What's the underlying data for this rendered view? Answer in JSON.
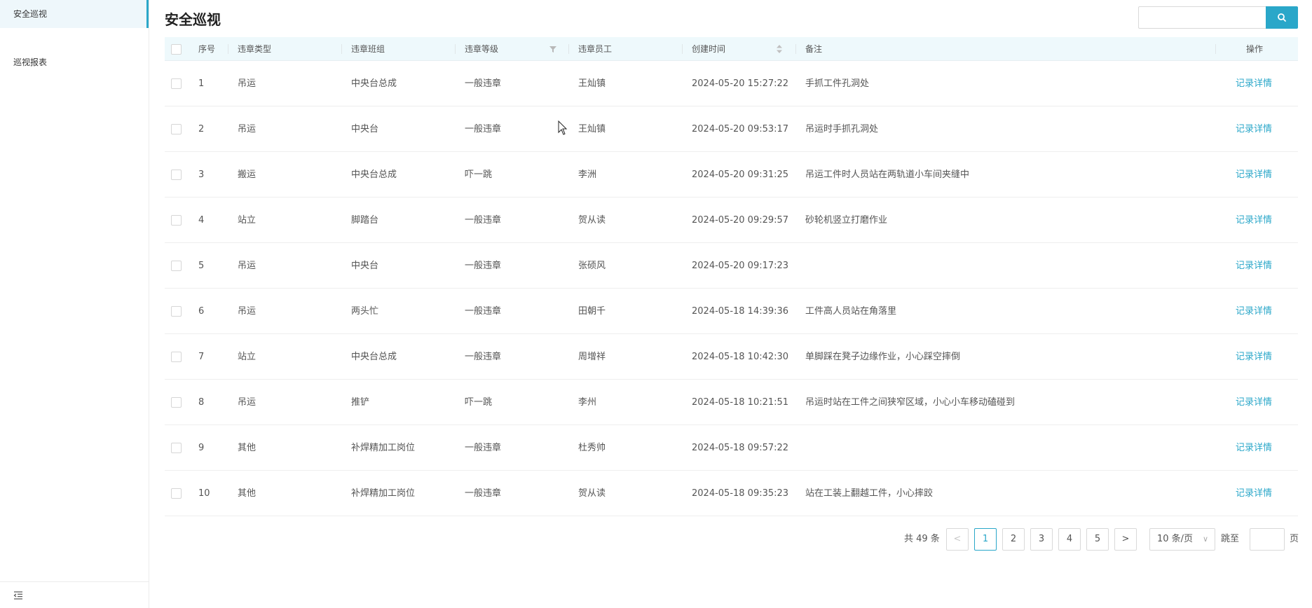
{
  "sidebar": {
    "items": [
      {
        "label": "安全巡视",
        "active": true
      },
      {
        "label": "巡视报表",
        "active": false
      }
    ],
    "collapse_icon": "menu-fold-icon"
  },
  "header": {
    "title": "安全巡视",
    "search": {
      "placeholder": "",
      "value": "",
      "icon": "search-icon"
    }
  },
  "table": {
    "columns": {
      "index": "序号",
      "type": "违章类型",
      "team": "违章班组",
      "level": "违章等级",
      "employee": "违章员工",
      "created": "创建时间",
      "remark": "备注",
      "action": "操作"
    },
    "rows": [
      {
        "index": "1",
        "type": "吊运",
        "team": "中央台总成",
        "level": "一般违章",
        "employee": "王灿镇",
        "created": "2024-05-20 15:27:22",
        "remark": "手抓工件孔洞处",
        "action": "记录详情"
      },
      {
        "index": "2",
        "type": "吊运",
        "team": "中央台",
        "level": "一般违章",
        "employee": "王灿镇",
        "created": "2024-05-20 09:53:17",
        "remark": "吊运时手抓孔洞处",
        "action": "记录详情"
      },
      {
        "index": "3",
        "type": "搬运",
        "team": "中央台总成",
        "level": "吓一跳",
        "employee": "李洲",
        "created": "2024-05-20 09:31:25",
        "remark": "吊运工件时人员站在两轨道小车间夹缝中",
        "action": "记录详情"
      },
      {
        "index": "4",
        "type": "站立",
        "team": "脚踏台",
        "level": "一般违章",
        "employee": "贺从读",
        "created": "2024-05-20 09:29:57",
        "remark": "砂轮机竖立打磨作业",
        "action": "记录详情"
      },
      {
        "index": "5",
        "type": "吊运",
        "team": "中央台",
        "level": "一般违章",
        "employee": "张硕风",
        "created": "2024-05-20 09:17:23",
        "remark": "",
        "action": "记录详情"
      },
      {
        "index": "6",
        "type": "吊运",
        "team": "两头忙",
        "level": "一般违章",
        "employee": "田朝千",
        "created": "2024-05-18 14:39:36",
        "remark": "工件高人员站在角落里",
        "action": "记录详情"
      },
      {
        "index": "7",
        "type": "站立",
        "team": "中央台总成",
        "level": "一般违章",
        "employee": "周增祥",
        "created": "2024-05-18 10:42:30",
        "remark": "单脚踩在凳子边缘作业，小心踩空摔倒",
        "action": "记录详情"
      },
      {
        "index": "8",
        "type": "吊运",
        "team": "推铲",
        "level": "吓一跳",
        "employee": "李州",
        "created": "2024-05-18 10:21:51",
        "remark": "吊运时站在工件之间狭窄区域，小心小车移动磕碰到",
        "action": "记录详情"
      },
      {
        "index": "9",
        "type": "其他",
        "team": "补焊精加工岗位",
        "level": "一般违章",
        "employee": "杜秀帅",
        "created": "2024-05-18 09:57:22",
        "remark": "",
        "action": "记录详情"
      },
      {
        "index": "10",
        "type": "其他",
        "team": "补焊精加工岗位",
        "level": "一般违章",
        "employee": "贺从读",
        "created": "2024-05-18 09:35:23",
        "remark": "站在工装上翻越工件，小心摔跤",
        "action": "记录详情"
      }
    ]
  },
  "pagination": {
    "total": "共 49 条",
    "prev": "<",
    "next": ">",
    "pages": [
      "1",
      "2",
      "3",
      "4",
      "5"
    ],
    "current": "1",
    "page_size": "10 条/页",
    "jump_label": "跳至",
    "jump_suffix": "页",
    "jump_value": ""
  },
  "colors": {
    "accent": "#2aa7c9",
    "header_bg": "#eef9fc",
    "active_bg": "#eef7fb"
  }
}
